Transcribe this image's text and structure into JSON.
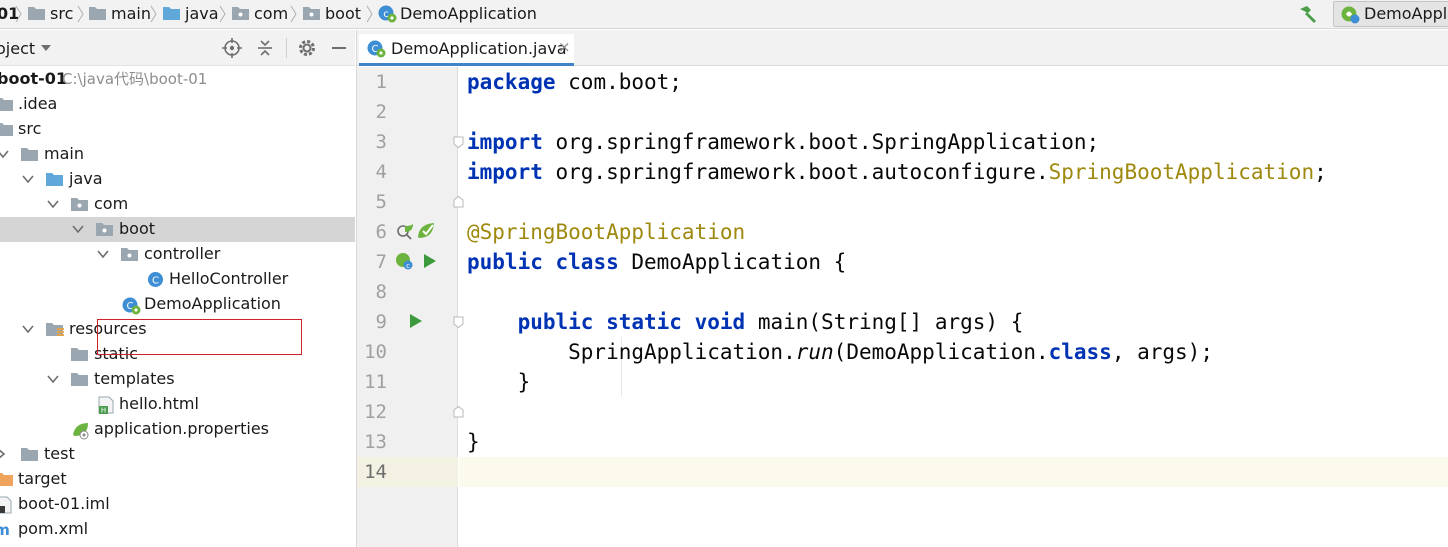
{
  "navbar": {
    "crumbs": [
      "01",
      "src",
      "main",
      "java",
      "com",
      "boot",
      "DemoApplication"
    ],
    "run_config": "DemoAppli"
  },
  "project": {
    "view_selector": "oject",
    "rows": [
      {
        "label": "boot-01",
        "hint": "C:\\java代码\\boot-01"
      },
      {
        "label": ".idea"
      },
      {
        "label": "src"
      },
      {
        "label": "main"
      },
      {
        "label": "java"
      },
      {
        "label": "com"
      },
      {
        "label": "boot"
      },
      {
        "label": "controller"
      },
      {
        "label": "HelloController"
      },
      {
        "label": "DemoApplication"
      },
      {
        "label": "resources"
      },
      {
        "label": "static"
      },
      {
        "label": "templates"
      },
      {
        "label": "hello.html"
      },
      {
        "label": "application.properties"
      },
      {
        "label": "test"
      },
      {
        "label": "target"
      },
      {
        "label": "boot-01.iml"
      },
      {
        "label": "pom.xml"
      }
    ]
  },
  "editor": {
    "tab_label": "DemoApplication.java",
    "tab_close": "×",
    "line_numbers": [
      "1",
      "2",
      "3",
      "4",
      "5",
      "6",
      "7",
      "8",
      "9",
      "10",
      "11",
      "12",
      "13",
      "14"
    ],
    "lines": [
      [
        {
          "t": "package",
          "c": "kw"
        },
        {
          "t": " com.boot;",
          "c": ""
        }
      ],
      [],
      [
        {
          "t": "import",
          "c": "kw"
        },
        {
          "t": " org.springframework.boot.SpringApplication;",
          "c": ""
        }
      ],
      [
        {
          "t": "import",
          "c": "kw"
        },
        {
          "t": " org.springframework.boot.autoconfigure.",
          "c": ""
        },
        {
          "t": "SpringBootApplication",
          "c": "unres"
        },
        {
          "t": ";",
          "c": ""
        }
      ],
      [],
      [
        {
          "t": "@SpringBootApplication",
          "c": "ann"
        }
      ],
      [
        {
          "t": "public",
          "c": "kw"
        },
        {
          "t": " ",
          "c": ""
        },
        {
          "t": "class",
          "c": "kw"
        },
        {
          "t": " DemoApplication {",
          "c": ""
        }
      ],
      [],
      [
        {
          "t": "    ",
          "c": ""
        },
        {
          "t": "public",
          "c": "kw"
        },
        {
          "t": " ",
          "c": ""
        },
        {
          "t": "static",
          "c": "kw"
        },
        {
          "t": " ",
          "c": ""
        },
        {
          "t": "void",
          "c": "kw"
        },
        {
          "t": " main(String[] args) {",
          "c": ""
        }
      ],
      [
        {
          "t": "        SpringApplication.",
          "c": ""
        },
        {
          "t": "run",
          "c": "ital"
        },
        {
          "t": "(DemoApplication.",
          "c": ""
        },
        {
          "t": "class",
          "c": "kw"
        },
        {
          "t": ", args);",
          "c": ""
        }
      ],
      [
        {
          "t": "    }",
          "c": ""
        }
      ],
      [],
      [
        {
          "t": "}",
          "c": ""
        }
      ],
      []
    ]
  },
  "colors": {
    "keyword": "#0033b3",
    "annotation": "#9e880d",
    "selection": "#d5d5d5",
    "highlight_box": "#d0212b",
    "run_icon": "#3c9a3c"
  }
}
